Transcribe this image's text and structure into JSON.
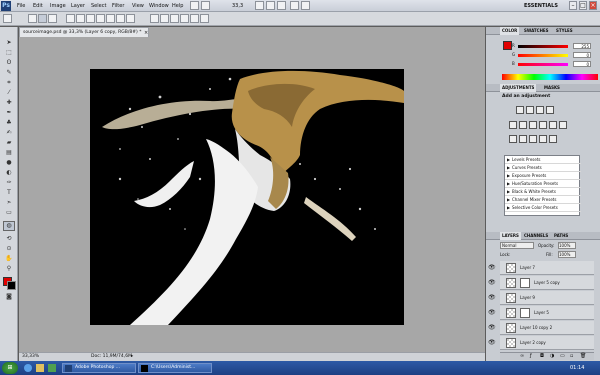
{
  "app": {
    "logo": "Ps",
    "menus": [
      "File",
      "Edit",
      "Image",
      "Layer",
      "Select",
      "Filter",
      "View",
      "Window",
      "Help"
    ],
    "zoom": "33,3",
    "workspace": "ESSENTIALS",
    "window_controls": [
      "minimize-icon",
      "maximize-icon",
      "close-icon"
    ]
  },
  "document": {
    "tab_title": "sourceimage.psd @ 33,3% (Layer 6 copy, RGB/8#) *",
    "zoom_status": "33,33%",
    "doc_info": "Doc: 11,9M/74,6M"
  },
  "panels": {
    "color_tabs": [
      "COLOR",
      "SWATCHES",
      "STYLES"
    ],
    "color_values": {
      "r": "255",
      "g": "0",
      "b": "0"
    },
    "color_labels": [
      "R",
      "G",
      "B"
    ],
    "adjustments_tabs": [
      "ADJUSTMENTS",
      "MASKS"
    ],
    "adjustments_title": "Add an adjustment",
    "presets": [
      "Levels Presets",
      "Curves Presets",
      "Exposure Presets",
      "Hue/Saturation Presets",
      "Black & White Presets",
      "Channel Mixer Presets",
      "Selective Color Presets"
    ],
    "layers_tabs": [
      "LAYERS",
      "CHANNELS",
      "PATHS"
    ],
    "blend_mode": "Normal",
    "opacity_label": "Opacity:",
    "opacity_value": "100%",
    "fill_label": "Fill:",
    "fill_value": "100%",
    "lock_label": "Lock:",
    "layers": [
      {
        "name": "Layer 7",
        "mask": false
      },
      {
        "name": "Layer 5 copy",
        "mask": true
      },
      {
        "name": "Layer 9",
        "mask": false
      },
      {
        "name": "Layer 5",
        "mask": true
      },
      {
        "name": "Layer 10 copy 2",
        "mask": false
      },
      {
        "name": "Layer 2 copy",
        "mask": false
      }
    ]
  },
  "taskbar": {
    "start": "⊞",
    "buttons": [
      "Adobe Photoshop ...",
      "C:\\Users\\Administ..."
    ],
    "clock": "01:14"
  },
  "colors": {
    "foreground": "#e00000",
    "background": "#000000",
    "accent": "#2d5aa6"
  }
}
